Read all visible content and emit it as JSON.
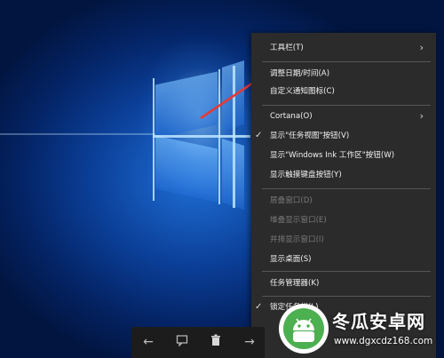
{
  "menu": {
    "items": [
      {
        "label": "工具栏(T)",
        "submenu": true,
        "checked": false,
        "disabled": false
      },
      {
        "label": "调整日期/时间(A)",
        "submenu": false,
        "checked": false,
        "disabled": false
      },
      {
        "label": "自定义通知图标(C)",
        "submenu": false,
        "checked": false,
        "disabled": false
      },
      {
        "label": "Cortana(O)",
        "submenu": true,
        "checked": false,
        "disabled": false
      },
      {
        "label": "显示\"任务视图\"按钮(V)",
        "submenu": false,
        "checked": true,
        "disabled": false
      },
      {
        "label": "显示\"Windows Ink 工作区\"按钮(W)",
        "submenu": false,
        "checked": false,
        "disabled": false
      },
      {
        "label": "显示触摸键盘按钮(Y)",
        "submenu": false,
        "checked": false,
        "disabled": false
      },
      {
        "label": "层叠窗口(D)",
        "submenu": false,
        "checked": false,
        "disabled": true
      },
      {
        "label": "堆叠显示窗口(E)",
        "submenu": false,
        "checked": false,
        "disabled": true
      },
      {
        "label": "并排显示窗口(I)",
        "submenu": false,
        "checked": false,
        "disabled": true
      },
      {
        "label": "显示桌面(S)",
        "submenu": false,
        "checked": false,
        "disabled": false
      },
      {
        "label": "任务管理器(K)",
        "submenu": false,
        "checked": false,
        "disabled": false
      },
      {
        "label": "锁定任务栏(L)",
        "submenu": false,
        "checked": true,
        "disabled": false
      }
    ]
  },
  "icons": {
    "chevron": "›",
    "check": "✓",
    "back": "←",
    "comment": "comment-icon",
    "trash": "trash-icon",
    "forward": "→"
  },
  "watermark": {
    "title": "冬瓜安卓网",
    "url": "www.dgxcdz168.com"
  },
  "colors": {
    "menu_bg": "#2b2b2b",
    "menu_text": "#f2f2f2",
    "disabled_text": "#7a7a7a",
    "arrow": "#e53935",
    "logo_green": "#4caf50"
  }
}
